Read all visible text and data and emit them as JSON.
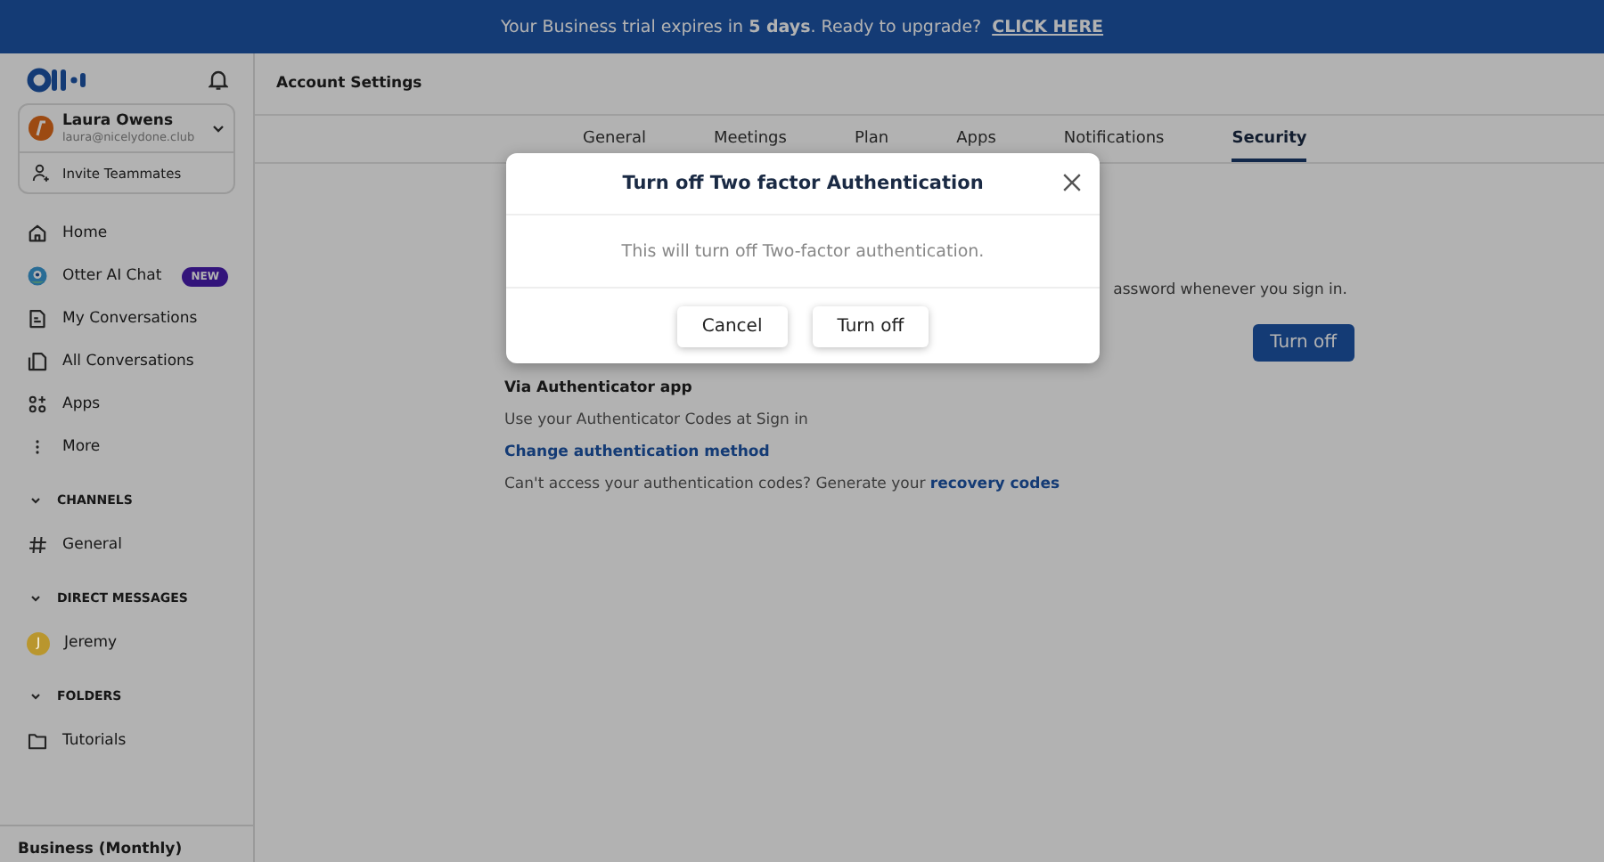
{
  "banner": {
    "text": "Your Business trial expires in **5 days**. Ready to upgrade?",
    "link": "CLICK HERE"
  },
  "sidebar": {
    "user": {
      "name": "Laura Owens",
      "email": "laura@nicelydone.club"
    },
    "invite": "Invite Teammates",
    "items": [
      {
        "kind": "home",
        "label": "Home"
      },
      {
        "kind": "chat",
        "label": "Otter AI Chat",
        "badge": "NEW"
      },
      {
        "kind": "doc",
        "label": "My Conversations"
      },
      {
        "kind": "docs",
        "label": "All Conversations"
      },
      {
        "kind": "apps",
        "label": "Apps"
      },
      {
        "kind": "more",
        "label": "More"
      }
    ],
    "sections": [
      {
        "title": "CHANNELS",
        "items": [
          {
            "kind": "hash",
            "label": "General"
          }
        ]
      },
      {
        "title": "DIRECT MESSAGES",
        "items": [
          {
            "kind": "avatar",
            "label": "Jeremy",
            "initial": "J",
            "color": "#b9962e"
          }
        ]
      },
      {
        "title": "FOLDERS",
        "items": [
          {
            "kind": "folder",
            "label": "Tutorials"
          }
        ]
      }
    ],
    "plan": "Business (Monthly)"
  },
  "header": {
    "title": "Account Settings"
  },
  "tabs": [
    {
      "label": "General",
      "selected": false
    },
    {
      "label": "Meetings",
      "selected": false
    },
    {
      "label": "Plan",
      "selected": false
    },
    {
      "label": "Apps",
      "selected": false
    },
    {
      "label": "Notifications",
      "selected": false
    },
    {
      "label": "Security",
      "selected": true
    }
  ],
  "security": {
    "description": "assword whenever you sign in.",
    "button": "Turn off",
    "method_title": "Via Authenticator app",
    "method_text": "Use your Authenticator Codes at Sign in",
    "change_link": "Change authentication method",
    "recovery_text": "Can't access your authentication codes? Generate your",
    "recovery_link": "recovery codes"
  },
  "dialog": {
    "title": "Turn off Two factor Authentication",
    "message": "This will turn off Two-factor authentication.",
    "buttons": [
      "Cancel",
      "Turn off"
    ]
  }
}
